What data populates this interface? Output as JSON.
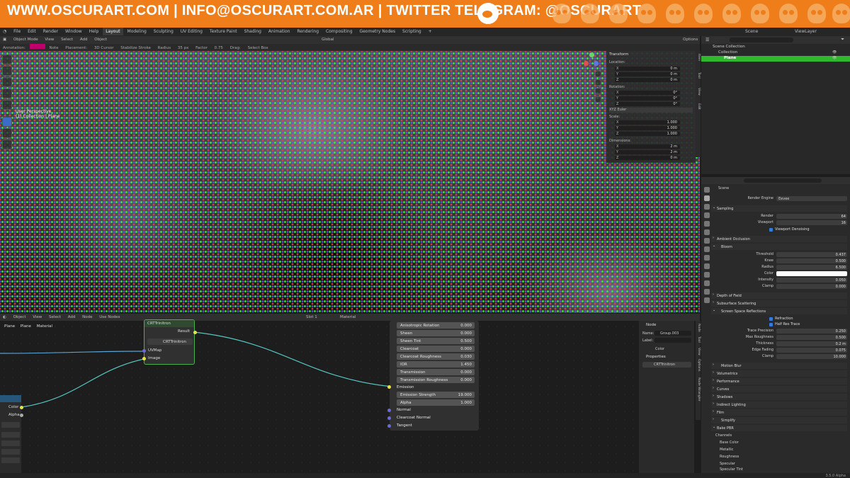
{
  "banner": {
    "text": "WWW.OSCURART.COM | INFO@OSCURART.COM.AR | TWITTER TELEGRAM: @OSCURART"
  },
  "topbar": {
    "menus": [
      "File",
      "Edit",
      "Render",
      "Window",
      "Help"
    ],
    "workspaces": [
      "Layout",
      "Modeling",
      "Sculpting",
      "UV Editing",
      "Texture Paint",
      "Shading",
      "Animation",
      "Rendering",
      "Compositing",
      "Geometry Nodes",
      "Scripting"
    ],
    "active_workspace": "Layout",
    "add_tab": "+",
    "scene": "Scene",
    "view_layer": "ViewLayer"
  },
  "viewport_header": {
    "mode": "Object Mode",
    "menus": [
      "View",
      "Select",
      "Add",
      "Object"
    ],
    "transform": "Global",
    "options_label": "Options"
  },
  "viewport_toolsettings": {
    "items": [
      "Annotation:",
      "Note",
      "Placement:",
      "3D Cursor",
      "Stabilize Stroke",
      "Radius",
      "Factor",
      "Drag:",
      "Select Box"
    ],
    "radius_value": "35 px",
    "factor_value": "0.75",
    "annotation_color": "#c0006a"
  },
  "viewport_overlay": {
    "line1": "User Perspective",
    "line2": "(1) Collection | Plane"
  },
  "npanel": {
    "header": "Transform",
    "sections": {
      "location": "Location:",
      "rotation": "Rotation:",
      "rotation_mode": "XYZ Euler",
      "scale": "Scale:",
      "dimensions": "Dimensions:"
    },
    "axes": [
      "X",
      "Y",
      "Z"
    ],
    "location": [
      "0 m",
      "0 m",
      "0 m"
    ],
    "rotation": [
      "0°",
      "0°",
      "0°"
    ],
    "scale": [
      "1.000",
      "1.000",
      "1.000"
    ],
    "dimensions": [
      "2 m",
      "2 m",
      "0 m"
    ],
    "tabs": [
      "Item",
      "Tool",
      "View",
      "Edit"
    ]
  },
  "outliner": {
    "rows": [
      "Scene Collection",
      "Collection",
      "Plane"
    ]
  },
  "properties": {
    "scene_name": "Scene",
    "render_engine_label": "Render Engine",
    "render_engine": "Eevee",
    "sampling": {
      "title": "Sampling",
      "render_label": "Render",
      "render": "64",
      "viewport_label": "Viewport",
      "viewport": "16",
      "denoise_label": "Viewport Denoising"
    },
    "ambient_occlusion": "Ambient Occlusion",
    "bloom": {
      "title": "Bloom",
      "rows": [
        {
          "label": "Threshold",
          "value": "0.437"
        },
        {
          "label": "Knee",
          "value": "0.500"
        },
        {
          "label": "Radius",
          "value": "6.500"
        },
        {
          "label": "Color",
          "value": ""
        },
        {
          "label": "Intensity",
          "value": "0.050"
        },
        {
          "label": "Clamp",
          "value": "0.000"
        }
      ],
      "color": "#ffffff"
    },
    "depth_of_field": "Depth of Field",
    "subsurface": "Subsurface Scattering",
    "ssr": {
      "title": "Screen Space Reflections",
      "refraction": "Refraction",
      "half_res": "Half Res Trace",
      "rows": [
        {
          "label": "Trace Precision",
          "value": "0.250"
        },
        {
          "label": "Max Roughness",
          "value": "0.500"
        },
        {
          "label": "Thickness",
          "value": "0.2 m"
        },
        {
          "label": "Edge Fading",
          "value": "0.075"
        },
        {
          "label": "Clamp",
          "value": "10.000"
        }
      ]
    },
    "sections": [
      "Motion Blur",
      "Volumetrics",
      "Performance",
      "Curves",
      "Shadows",
      "Indirect Lighting",
      "Film",
      "Simplify"
    ],
    "bake_pbr": "Bake PBR",
    "channels_label": "Channels",
    "channels": [
      "Base Color",
      "Metallic",
      "Roughness",
      "Specular",
      "Specular Tint"
    ]
  },
  "node_editor": {
    "header": {
      "type": "Object",
      "menus": [
        "View",
        "Select",
        "Add",
        "Node"
      ],
      "use_nodes": "Use Nodes",
      "slot": "Slot 1",
      "material": "Material"
    },
    "breadcrumb": [
      "Plane",
      "Plane",
      "Material"
    ],
    "group_node": {
      "title": "CRTTrinitron",
      "output": "Result",
      "datablock": "CRTTrinitron",
      "inputs": [
        "UVMap",
        "Image"
      ]
    },
    "left_node": {
      "outputs": [
        "Color",
        "Alpha"
      ]
    },
    "bsdf": {
      "rows": [
        {
          "label": "Anisotropic Rotation",
          "value": "0.000"
        },
        {
          "label": "Sheen",
          "value": "0.000"
        },
        {
          "label": "Sheen Tint",
          "value": "0.500"
        },
        {
          "label": "Clearcoat",
          "value": "0.000"
        },
        {
          "label": "Clearcoat Roughness",
          "value": "0.030"
        },
        {
          "label": "IOR",
          "value": "1.450"
        },
        {
          "label": "Transmission",
          "value": "0.000"
        },
        {
          "label": "Transmission Roughness",
          "value": "0.000"
        }
      ],
      "emission": "Emission",
      "rows2": [
        {
          "label": "Emission Strength",
          "value": "19.000"
        },
        {
          "label": "Alpha",
          "value": "1.000"
        }
      ],
      "outputs": [
        "Normal",
        "Clearcoat Normal",
        "Tangent"
      ]
    },
    "sidebar": {
      "title": "Node",
      "name_label": "Name:",
      "name": "Group.003",
      "label_label": "Label:",
      "color_label": "Color",
      "properties_label": "Properties",
      "group_ref": "CRTTrinitron",
      "tabs": [
        "Node",
        "Tool",
        "View",
        "Options",
        "Node Wrangler"
      ]
    }
  },
  "status": {
    "version": "3.5.0 Alpha"
  }
}
